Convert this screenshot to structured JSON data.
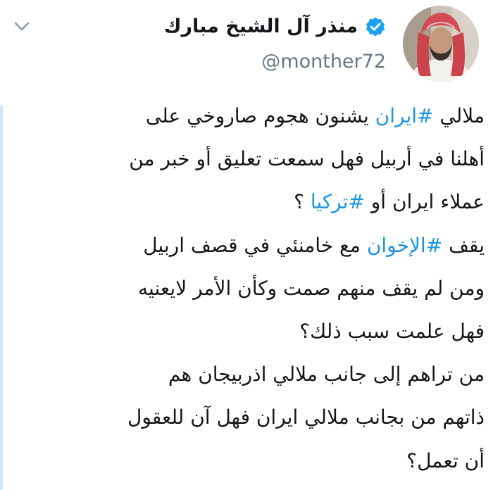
{
  "author": {
    "display_name": "منذر آل الشيخ مبارك",
    "handle": "@monther72",
    "verified": true
  },
  "icons": {
    "menu": "chevron-down-icon",
    "verified": "verified-badge-icon"
  },
  "colors": {
    "hashtag": "#1b95e0",
    "text": "#14171a",
    "handle": "#657786",
    "verified_badge": "#1da1f2"
  },
  "tweet": {
    "lines": [
      {
        "a": "ملالي ",
        "b": "#ايران",
        "c": " يشنون هجوم صاروخي على"
      },
      {
        "a": "أهلنا في أربيل فهل سمعت تعليق أو خبر من"
      },
      {
        "a": "عملاء ايران أو ",
        "b": "#تركيا",
        "c": " ؟"
      },
      {
        "a": "يقف ",
        "b": "#الإخوان",
        "c": " مع خامنئي في قصف اربيل"
      },
      {
        "a": "ومن لم يقف منهم صمت وكأن الأمر لايعنيه"
      },
      {
        "a": "فهل علمت سبب ذلك؟"
      },
      {
        "a": "من تراهم إلى جانب ملالي اذربيجان هم"
      },
      {
        "a": "ذاتهم من بجانب ملالي ايران فهل آن للعقول"
      },
      {
        "a": "أن تعمل؟"
      }
    ]
  }
}
